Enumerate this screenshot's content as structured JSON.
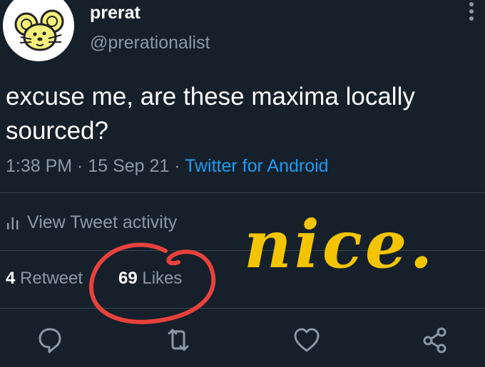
{
  "author": {
    "display_name": "prerat",
    "handle": "@prerationalist",
    "avatar_icon": "mouse-avatar-icon"
  },
  "tweet": {
    "text": "excuse me, are these maxima locally sourced?",
    "time": "1:38 PM",
    "date": "15 Sep 21",
    "separator": " · ",
    "source": "Twitter for Android"
  },
  "activity": {
    "label": "View Tweet activity",
    "icon": "bar-chart-icon"
  },
  "stats": {
    "retweets_count": "4",
    "retweets_label": "Retweet",
    "likes_count": "69",
    "likes_label": "Likes"
  },
  "actions": [
    {
      "icon": "reply-icon"
    },
    {
      "icon": "retweet-icon"
    },
    {
      "icon": "like-icon"
    },
    {
      "icon": "share-icon"
    }
  ],
  "annotation": {
    "handwritten_text": "nice.",
    "circle_color": "#e8413c",
    "text_color": "#f4c400"
  },
  "colors": {
    "background": "#15202b",
    "primary_text": "#ffffff",
    "secondary_text": "#8b98a5",
    "link": "#1d9bf0",
    "divider": "#38444d"
  }
}
